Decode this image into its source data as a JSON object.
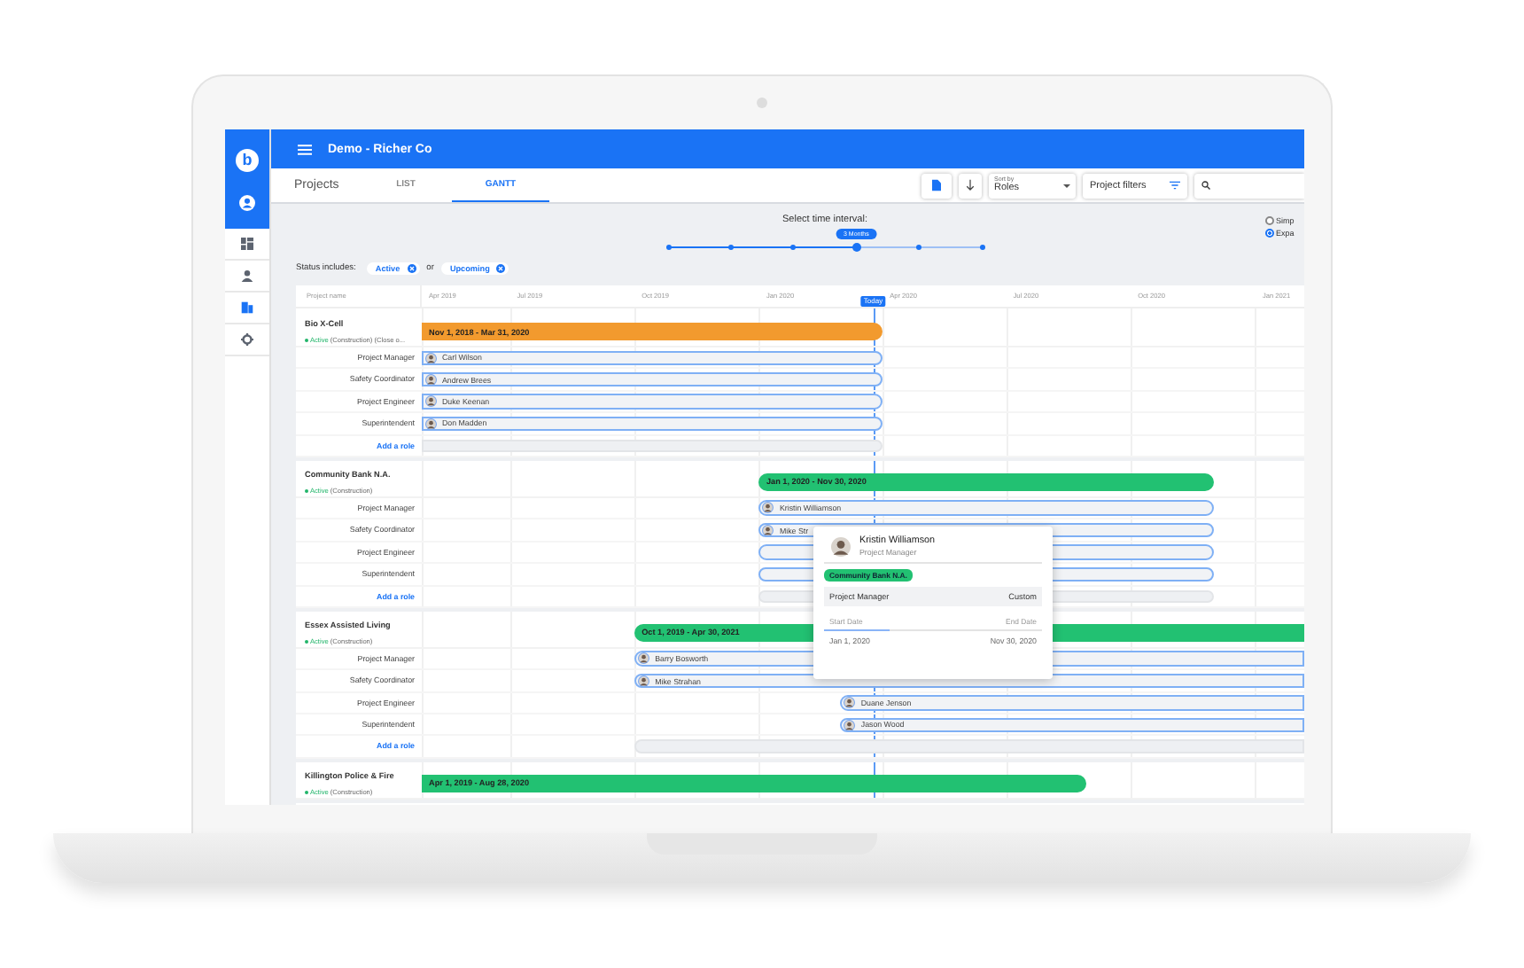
{
  "app": {
    "logo": "b",
    "title": "Demo - Richer Co"
  },
  "sidebar": {
    "items": [
      {
        "kind": "dashboard",
        "selected": false
      },
      {
        "kind": "person",
        "selected": false
      },
      {
        "kind": "building",
        "selected": true
      },
      {
        "kind": "gear",
        "selected": false
      }
    ]
  },
  "page_title": "Projects",
  "tabs": [
    {
      "label": "LIST",
      "selected": false
    },
    {
      "label": "GANTT",
      "selected": true
    }
  ],
  "toolbar": {
    "sort_label": "Sort by",
    "sort_value": "Roles",
    "filters": "Project filters"
  },
  "time_interval": {
    "label": "Select time interval:",
    "bubble": "3 Months",
    "level": 0.6
  },
  "view_options": [
    {
      "label": "Simp",
      "selected": false
    },
    {
      "label": "Expa",
      "selected": true
    }
  ],
  "status_filter": {
    "label": "Status includes:",
    "joiner": "or",
    "chips": [
      "Active",
      "Upcoming"
    ]
  },
  "gantt": {
    "name_header": "Project name",
    "columns": [
      "Apr 2019",
      "Jul 2019",
      "Oct 2019",
      "Jan 2020",
      "Apr 2020",
      "Jul 2020",
      "Oct 2020",
      "Jan 2021"
    ],
    "today": {
      "label": "Today"
    },
    "projects": [
      {
        "name": "Bio X-Cell",
        "status": "Active",
        "active": true,
        "detail": "(Construction) (Close o...",
        "bar_label": "Nov 1, 2018 - Mar 31, 2020",
        "color": "#f29a2e",
        "add_role": "Add a role",
        "roles": [
          {
            "role": "Project Manager",
            "person": "Carl Wilson",
            "kind": "full"
          },
          {
            "role": "Safety Coordinator",
            "person": "Andrew Brees",
            "kind": "full"
          },
          {
            "role": "Project Engineer",
            "person": "Duke Keenan",
            "kind": "full"
          },
          {
            "role": "Superintendent",
            "person": "Don Madden",
            "kind": "full"
          }
        ]
      },
      {
        "name": "Community Bank N.A.",
        "status": "Active",
        "active": true,
        "detail": "(Construction)",
        "bar_label": "Jan 1, 2020 - Nov 30, 2020",
        "color": "#22c172",
        "add_role": "Add a role",
        "roles": [
          {
            "role": "Project Manager",
            "person": "Kristin Williamson",
            "kind": "full"
          },
          {
            "role": "Safety Coordinator",
            "person": "Mike Str",
            "kind": "full"
          },
          {
            "role": "Project Engineer",
            "kind": "full"
          },
          {
            "role": "Superintendent",
            "kind": "full"
          }
        ]
      },
      {
        "name": "Essex Assisted Living",
        "status": "Active",
        "active": true,
        "detail": "(Construction)",
        "bar_label": "Oct 1, 2019 - Apr 30, 2021",
        "color": "#22c172",
        "add_role": "Add a role",
        "roles": [
          {
            "role": "Project Manager",
            "person": "Barry Bosworth",
            "kind": "full"
          },
          {
            "role": "Safety Coordinator",
            "person": "Mike Strahan",
            "kind": "full"
          },
          {
            "role": "Project Engineer",
            "person": "Duane Jenson",
            "kind": "partial"
          },
          {
            "role": "Superintendent",
            "person": "Jason Wood",
            "kind": "partial"
          }
        ]
      },
      {
        "name": "Killington Police & Fire",
        "status": "Active",
        "active": true,
        "detail": "(Construction)",
        "bar_label": "Apr 1, 2019 - Aug 28, 2020",
        "color": "#22c172"
      }
    ]
  },
  "tooltip": {
    "person": "Kristin Williamson",
    "role": "Project Manager",
    "project": "Community Bank N.A.",
    "role_row": "Project Manager",
    "role_type": "Custom",
    "start_label": "Start Date",
    "end_label": "End Date",
    "level": 0.3,
    "start": "Jan 1, 2020",
    "end": "Nov 30, 2020"
  }
}
